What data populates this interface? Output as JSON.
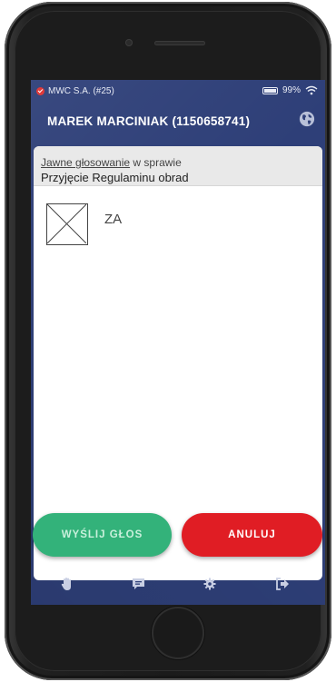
{
  "status_bar": {
    "carrier": "MWC S.A. (#25)",
    "battery_percent": "99%",
    "icons": [
      "status-check-icon",
      "battery-icon",
      "wifi-icon"
    ]
  },
  "header": {
    "title": "MAREK MARCINIAK (1150658741)",
    "icon": "globe-icon"
  },
  "vote": {
    "mode_link": "Jawne głosowanie",
    "mode_suffix": " w sprawie",
    "subject": "Przyjęcie Regulaminu obrad",
    "option": {
      "label": "ZA",
      "checked": false
    }
  },
  "actions": {
    "send_label": "WYŚLIJ GŁOS",
    "cancel_label": "ANULUJ"
  },
  "nav": {
    "items": [
      "hand-icon",
      "message-icon",
      "gear-icon",
      "logout-icon"
    ]
  },
  "colors": {
    "background": "#2e3f78",
    "send": "#33b27a",
    "cancel": "#e01d24",
    "status_dot": "#e03a3a"
  }
}
